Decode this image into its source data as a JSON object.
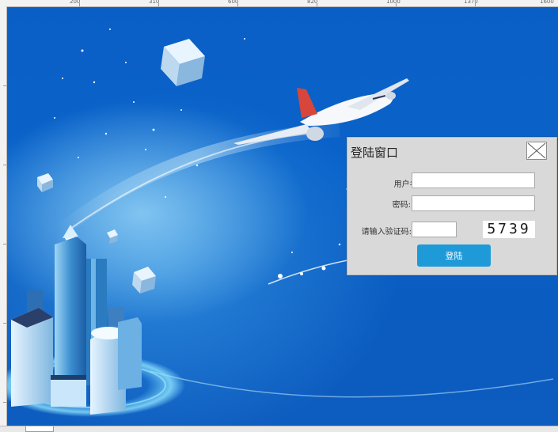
{
  "ruler": {
    "marks": [
      "200",
      "310",
      "600",
      "820",
      "1000",
      "1370",
      "1600"
    ]
  },
  "dialog": {
    "title": "登陆窗口",
    "username_label": "用户名:",
    "username_value": "",
    "password_label": "密码:",
    "password_value": "",
    "captcha_label": "请输入验证码:",
    "captcha_input_value": "",
    "captcha_text": "5739",
    "login_button": "登陆",
    "close_icon": "close-x-icon"
  },
  "colors": {
    "background_blue": "#0a5fc6",
    "dialog_bg": "#d9d9d9",
    "button_blue": "#1f9ad8"
  }
}
